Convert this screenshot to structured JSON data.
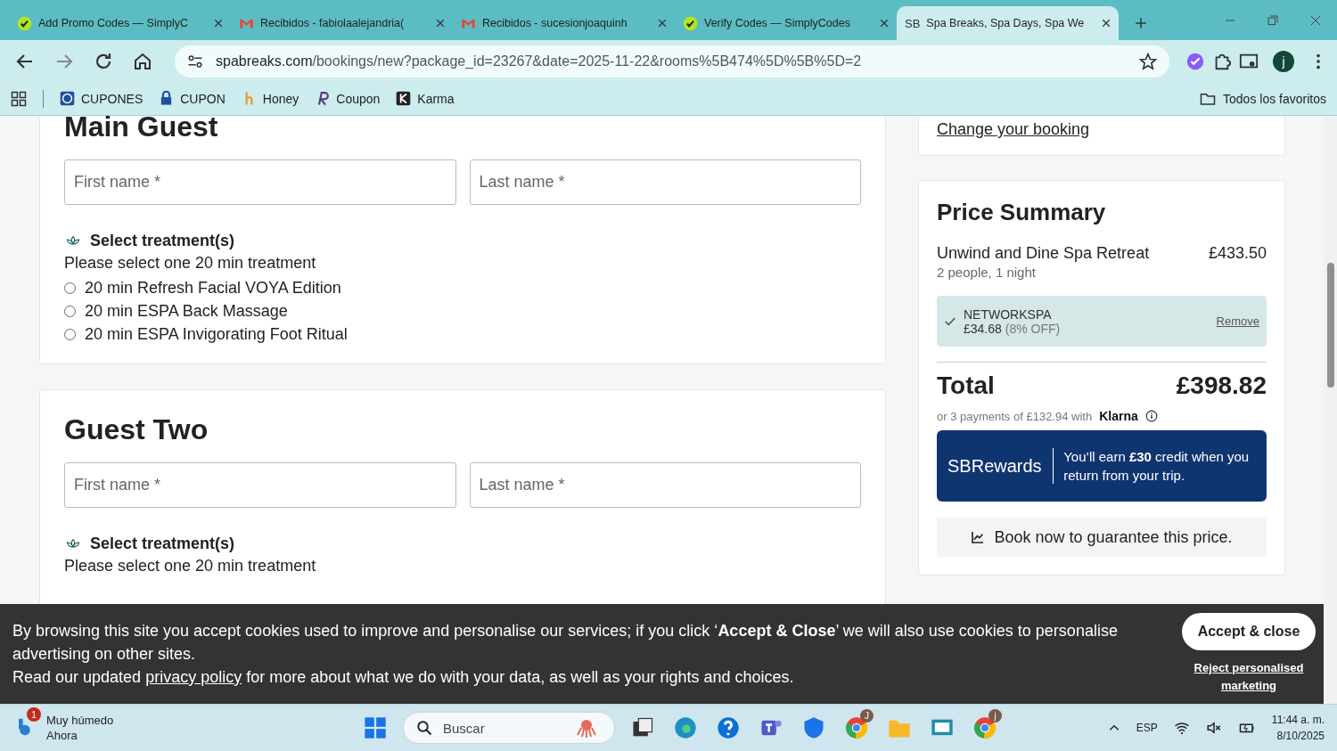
{
  "browser": {
    "tabs": [
      {
        "title": "Add Promo Codes — SimplyC",
        "kind": "simplycodes",
        "selected": false
      },
      {
        "title": "Recibidos - fabiolaalejandria(",
        "kind": "gmail",
        "selected": false
      },
      {
        "title": "Recibidos - sucesionjoaquinh",
        "kind": "gmail",
        "selected": false
      },
      {
        "title": "Verify Codes — SimplyCodes",
        "kind": "simplycodes",
        "selected": false
      },
      {
        "title": "Spa Breaks, Spa Days, Spa We",
        "kind": "sb",
        "selected": true
      }
    ],
    "favicon_text": "SB",
    "url_host": "spabreaks.com",
    "url_path": "/bookings/new?package_id=23267&date=2025-11-22&rooms%5B474%5D%5B%5D=2",
    "profile": "j",
    "bookmarks": [
      {
        "label": "CUPONES",
        "kind": "globe"
      },
      {
        "label": "CUPON",
        "kind": "lock"
      },
      {
        "label": "Honey",
        "kind": "honey"
      },
      {
        "label": "Coupon",
        "kind": "r"
      },
      {
        "label": "Karma",
        "kind": "k"
      }
    ],
    "all_bookmarks": "Todos los favoritos"
  },
  "guests": [
    {
      "heading": "Main Guest",
      "first_name": {
        "placeholder": "First name *"
      },
      "last_name": {
        "placeholder": "Last name *"
      },
      "treatment_title": "Select treatment(s)",
      "instruction": "Please select one 20 min treatment",
      "options": [
        {
          "label": "20 min Refresh Facial VOYA Edition",
          "selected": false
        },
        {
          "label": "20 min ESPA Back Massage",
          "selected": false
        },
        {
          "label": "20 min ESPA Invigorating Foot Ritual",
          "selected": false
        }
      ]
    },
    {
      "heading": "Guest Two",
      "first_name": {
        "placeholder": "First name *"
      },
      "last_name": {
        "placeholder": "Last name *"
      },
      "treatment_title": "Select treatment(s)",
      "instruction": "Please select one 20 min treatment"
    }
  ],
  "summary": {
    "change_link": "Change your booking",
    "title": "Price Summary",
    "item": {
      "name": "Unwind and Dine Spa Retreat",
      "price": "£433.50",
      "detail": "2 people, 1 night"
    },
    "promo": {
      "code": "NETWORKSPA",
      "amount": "£34.68",
      "off": "(8% OFF)",
      "remove": "Remove"
    },
    "total_label": "Total",
    "total": "£398.82",
    "klarna_text": "or 3 payments of £132.94 with",
    "klarna": "Klarna",
    "rewards_brand_a": "SB",
    "rewards_brand_b": "Rewards",
    "rewards_text": "You’ll earn **£30** credit when you return from your trip.",
    "guarantee": "Book now to guarantee this price."
  },
  "cookie": {
    "text": "By browsing this site you accept cookies used to improve and personalise our services; if you click ‘**Accept & Close**’ we will also use cookies to personalise advertising on other sites.",
    "line2_before": "Read our updated",
    "link": "privacy policy",
    "line2_after": "for more about what we do with your data, as well as your rights and choices.",
    "accept": "Accept & close",
    "reject": "Reject personalised marketing"
  },
  "taskbar": {
    "weather": "Muy húmedo",
    "weather_time": "Ahora",
    "weather_badge": "1",
    "search": "Buscar",
    "lang": "ESP",
    "time": "11:44 a. m.",
    "date": "8/10/2025",
    "apps": [
      {
        "kind": "start"
      },
      {
        "kind": "files-dark"
      },
      {
        "kind": "edge"
      },
      {
        "kind": "help"
      },
      {
        "kind": "teams"
      },
      {
        "kind": "shield"
      },
      {
        "kind": "chrome",
        "badge": "J"
      },
      {
        "kind": "folder"
      },
      {
        "kind": "screen"
      },
      {
        "kind": "chrome",
        "badge": "j"
      }
    ]
  }
}
